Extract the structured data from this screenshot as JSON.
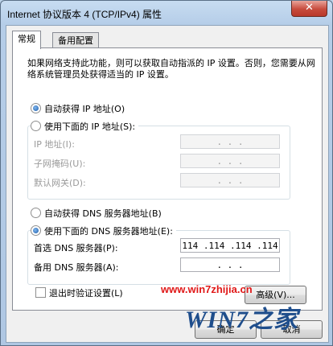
{
  "window": {
    "title": "Internet 协议版本 4 (TCP/IPv4) 属性",
    "close_glyph": "✕"
  },
  "tabs": [
    {
      "label": "常规",
      "active": true
    },
    {
      "label": "备用配置",
      "active": false
    }
  ],
  "description": "如果网络支持此功能，则可以获取自动指派的 IP 设置。否则，您需要从网络系统管理员处获得适当的 IP 设置。",
  "ip_section": {
    "auto_label": "自动获得 IP 地址(O)",
    "auto_selected": true,
    "manual_label": "使用下面的 IP 地址(S):",
    "manual_selected": false,
    "fields": [
      {
        "label": "IP 地址(I):",
        "value": ".       .       ."
      },
      {
        "label": "子网掩码(U):",
        "value": ".       .       ."
      },
      {
        "label": "默认网关(D):",
        "value": ".       .       ."
      }
    ]
  },
  "dns_section": {
    "auto_label": "自动获得 DNS 服务器地址(B)",
    "auto_selected": false,
    "manual_label": "使用下面的 DNS 服务器地址(E):",
    "manual_selected": true,
    "fields": [
      {
        "label": "首选 DNS 服务器(P):",
        "value": "114 .114 .114 .114"
      },
      {
        "label": "备用 DNS 服务器(A):",
        "value": ".       .       ."
      }
    ]
  },
  "validate": {
    "label": "退出时验证设置(L)",
    "checked": false
  },
  "advanced_button": "高级(V)...",
  "ok_button": "确定",
  "cancel_button": "取消",
  "watermark": {
    "url": "www.win7zhijia.cn",
    "logo": "WIN7之家"
  }
}
